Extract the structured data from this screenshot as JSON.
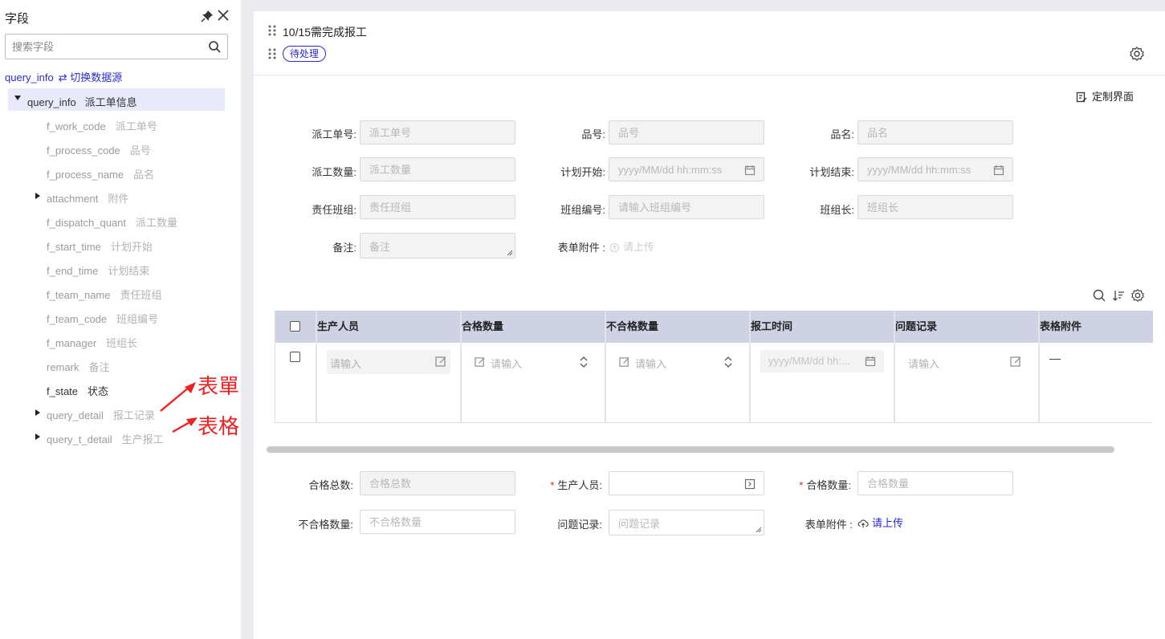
{
  "sidebar": {
    "title": "字段",
    "search_placeholder": "搜索字段",
    "source_name": "query_info",
    "switch_label": "⇄ 切换数据源",
    "root": {
      "name": "query_info",
      "label": "派工单信息"
    },
    "fields": [
      {
        "name": "f_work_code",
        "label": "派工单号"
      },
      {
        "name": "f_process_code",
        "label": "品号"
      },
      {
        "name": "f_process_name",
        "label": "品名"
      },
      {
        "name": "attachment",
        "label": "附件"
      },
      {
        "name": "f_dispatch_quant",
        "label": "派工数量"
      },
      {
        "name": "f_start_time",
        "label": "计划开始"
      },
      {
        "name": "f_end_time",
        "label": "计划结束"
      },
      {
        "name": "f_team_name",
        "label": "责任班组"
      },
      {
        "name": "f_team_code",
        "label": "班组编号"
      },
      {
        "name": "f_manager",
        "label": "班组长"
      },
      {
        "name": "remark",
        "label": "备注"
      },
      {
        "name": "f_state",
        "label": "状态"
      },
      {
        "name": "query_detail",
        "label": "报工记录"
      },
      {
        "name": "query_t_detail",
        "label": "生产报工"
      }
    ],
    "annotations": [
      "表單",
      "表格"
    ]
  },
  "header": {
    "title": "10/15需完成报工",
    "status": "待处理",
    "customize_label": "定制界面"
  },
  "form": {
    "work_code": {
      "label": "派工单号:",
      "placeholder": "派工单号"
    },
    "process_code": {
      "label": "品号:",
      "placeholder": "品号"
    },
    "process_name": {
      "label": "品名:",
      "placeholder": "品名"
    },
    "dispatch_quant": {
      "label": "派工数量:",
      "placeholder": "派工数量"
    },
    "start_time": {
      "label": "计划开始:",
      "placeholder": "yyyy/MM/dd hh:mm:ss"
    },
    "end_time": {
      "label": "计划结束:",
      "placeholder": "yyyy/MM/dd hh:mm:ss"
    },
    "team_name": {
      "label": "责任班组:",
      "placeholder": "责任班组"
    },
    "team_code": {
      "label": "班组编号:",
      "placeholder": "请输入班组编号"
    },
    "manager": {
      "label": "班组长:",
      "placeholder": "班组长"
    },
    "remark": {
      "label": "备注:",
      "placeholder": "备注"
    },
    "attachment": {
      "label": "表单附件 :",
      "upload": "请上传"
    }
  },
  "table": {
    "columns": [
      "生产人员",
      "合格数量",
      "不合格数量",
      "报工时间",
      "问题记录",
      "表格附件"
    ],
    "row": {
      "staff_placeholder": "请输入",
      "qualified_placeholder": "请输入",
      "unqualified_placeholder": "请输入",
      "time_placeholder": "yyyy/MM/dd hh:...",
      "issue_placeholder": "请输入",
      "attachment_value": "—"
    }
  },
  "bottom_form": {
    "total_qualified": {
      "label": "合格总数:",
      "placeholder": "合格总数"
    },
    "staff": {
      "label": "生产人员:",
      "required": "*"
    },
    "qualified_quantity": {
      "label": "合格数量:",
      "placeholder": "合格数量",
      "required": "*"
    },
    "unqualified_quantity": {
      "label": "不合格数量:",
      "placeholder": "不合格数量"
    },
    "issue_record": {
      "label": "问题记录:",
      "placeholder": "问题记录"
    },
    "attachment": {
      "label": "表单附件 :",
      "upload": "请上传"
    }
  },
  "colors": {
    "accent": "#2a2ad0",
    "header_bg": "#cfd1e4",
    "selected_bg": "#e8eafb",
    "annotation": "#ee2222"
  }
}
